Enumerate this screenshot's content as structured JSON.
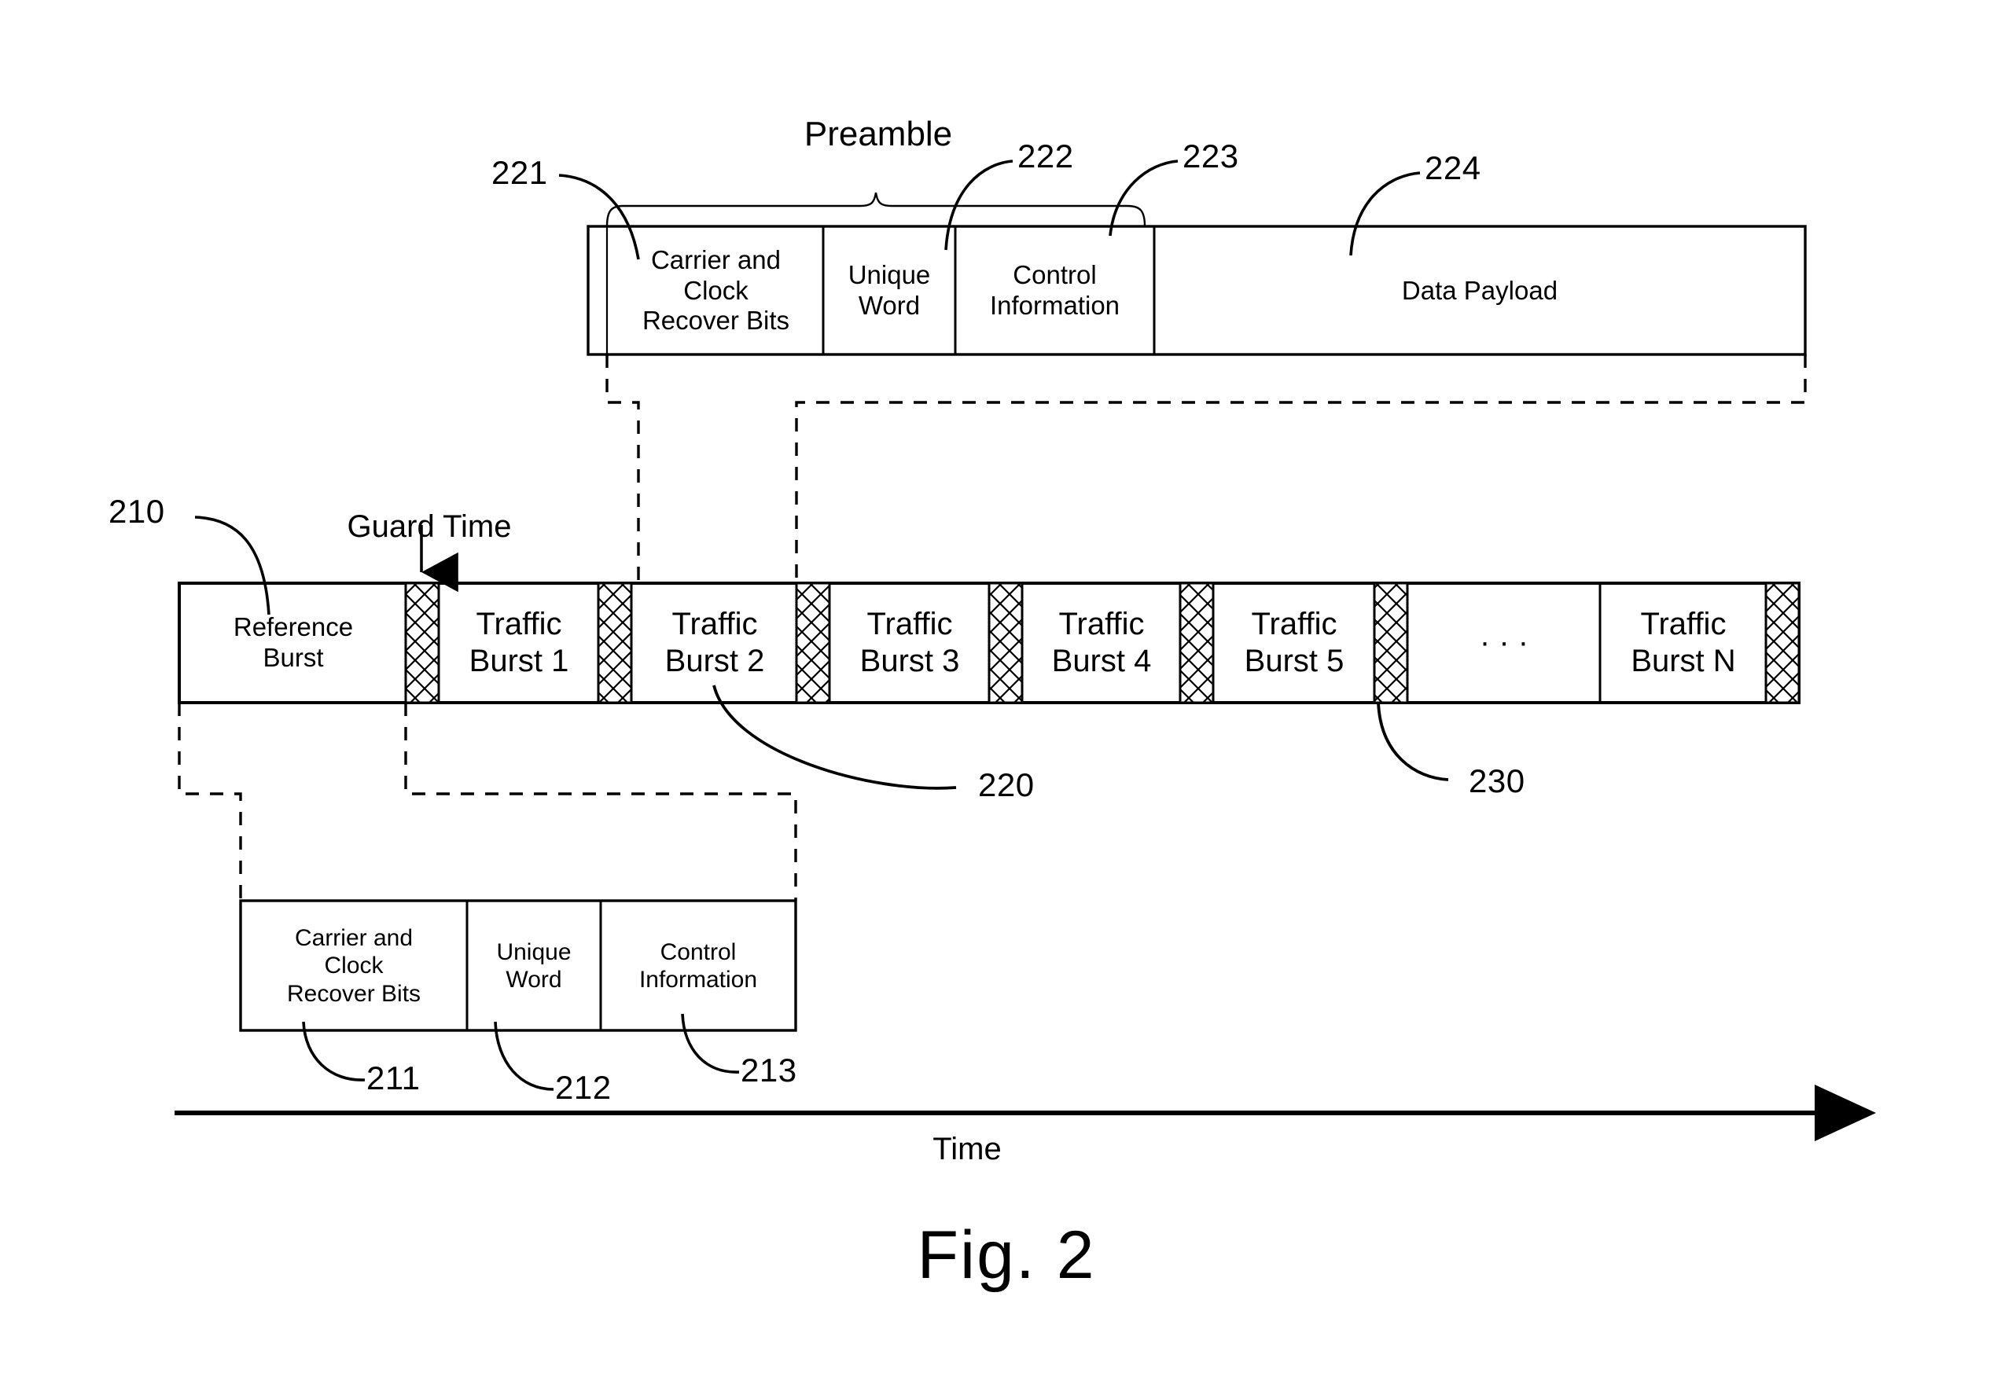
{
  "figure": {
    "caption": "Fig. 2",
    "time_axis_label": "Time",
    "preamble_brace_label": "Preamble",
    "guard_time_label": "Guard Time",
    "ellipsis": "· · ·"
  },
  "traffic_burst_detail": {
    "ref_frame": "221",
    "cells": [
      {
        "label": "Carrier and\nClock\nRecover Bits",
        "ref": "221",
        "name": "carrier-clock-recover-bits"
      },
      {
        "label": "Unique\nWord",
        "ref": "222",
        "name": "unique-word"
      },
      {
        "label": "Control\nInformation",
        "ref": "223",
        "name": "control-information"
      },
      {
        "label": "Data Payload",
        "ref": "224",
        "name": "data-payload"
      }
    ],
    "refs": {
      "r221": "221",
      "r222": "222",
      "r223": "223",
      "r224": "224"
    }
  },
  "frame_row": {
    "ref_frame": "210",
    "ref_traffic_burst": "220",
    "ref_guard_time": "230",
    "cells": [
      {
        "label": "Reference\nBurst",
        "type": "burst",
        "name": "reference-burst"
      },
      {
        "label": "",
        "type": "guard",
        "name": "guard-time-1"
      },
      {
        "label": "Traffic\nBurst 1",
        "type": "burst",
        "name": "traffic-burst-1"
      },
      {
        "label": "",
        "type": "guard",
        "name": "guard-time-2"
      },
      {
        "label": "Traffic\nBurst 2",
        "type": "burst",
        "name": "traffic-burst-2"
      },
      {
        "label": "",
        "type": "guard",
        "name": "guard-time-3"
      },
      {
        "label": "Traffic\nBurst 3",
        "type": "burst",
        "name": "traffic-burst-3"
      },
      {
        "label": "",
        "type": "guard",
        "name": "guard-time-4"
      },
      {
        "label": "Traffic\nBurst 4",
        "type": "burst",
        "name": "traffic-burst-4"
      },
      {
        "label": "",
        "type": "guard",
        "name": "guard-time-5"
      },
      {
        "label": "Traffic\nBurst 5",
        "type": "burst",
        "name": "traffic-burst-5"
      },
      {
        "label": "",
        "type": "guard",
        "name": "guard-time-6"
      },
      {
        "label": "· · ·",
        "type": "ellipsis",
        "name": "burst-ellipsis"
      },
      {
        "label": "Traffic\nBurst N",
        "type": "burst",
        "name": "traffic-burst-n"
      },
      {
        "label": "",
        "type": "guard",
        "name": "guard-time-7"
      }
    ]
  },
  "reference_burst_detail": {
    "cells": [
      {
        "label": "Carrier and\nClock\nRecover Bits",
        "ref": "211",
        "name": "ref-carrier-clock-recover-bits"
      },
      {
        "label": "Unique\nWord",
        "ref": "212",
        "name": "ref-unique-word"
      },
      {
        "label": "Control\nInformation",
        "ref": "213",
        "name": "ref-control-information"
      }
    ],
    "refs": {
      "r211": "211",
      "r212": "212",
      "r213": "213"
    }
  }
}
